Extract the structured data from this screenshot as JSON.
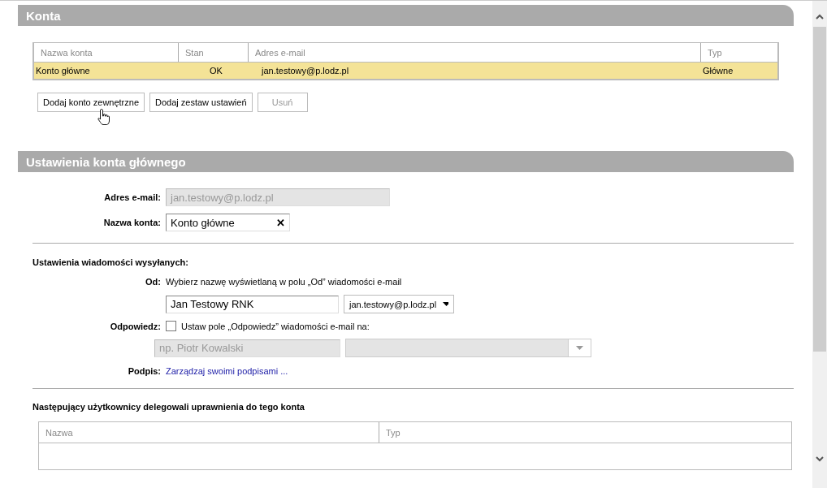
{
  "accounts_section": {
    "title": "Konta",
    "table": {
      "columns": [
        "Nazwa konta",
        "Stan",
        "Adres e-mail",
        "Typ"
      ],
      "rows": [
        {
          "cells": [
            "Konto główne",
            "OK",
            "jan.testowy@p.lodz.pl",
            "Główne"
          ],
          "selected": true
        }
      ]
    },
    "buttons": [
      {
        "label": "Dodaj konto zewnętrzne",
        "disabled": false
      },
      {
        "label": "Dodaj zestaw ustawień",
        "disabled": false
      },
      {
        "label": "Usuń",
        "disabled": true
      }
    ]
  },
  "settings_section": {
    "title": "Ustawienia konta głównego",
    "email": {
      "label": "Adres e-mail:",
      "value": "jan.testowy@p.lodz.pl",
      "disabled": true
    },
    "account_name": {
      "label": "Nazwa konta:",
      "value": "Konto główne",
      "clear": "✕"
    },
    "sent_heading": "Ustawienia wiadomości wysyłanych:",
    "from": {
      "label": "Od:",
      "hint": "Wybierz nazwę wyświetlaną w polu „Od” wiadomości e-mail",
      "name_value": "Jan Testowy RNK",
      "address": "jan.testowy@p.lodz.pl"
    },
    "reply": {
      "label": "Odpowiedz:",
      "checkbox_label": "Ustaw pole „Odpowiedz” wiadomości e-mail na:",
      "checked": false,
      "name_placeholder": "np. Piotr Kowalski"
    },
    "signature": {
      "label": "Podpis:",
      "link": "Zarządzaj swoimi podpisami ..."
    },
    "delegates_heading": "Następujący użytkownicy delegowali uprawnienia do tego konta",
    "delegates_table": {
      "columns": [
        "Nazwa",
        "Typ"
      ]
    }
  }
}
